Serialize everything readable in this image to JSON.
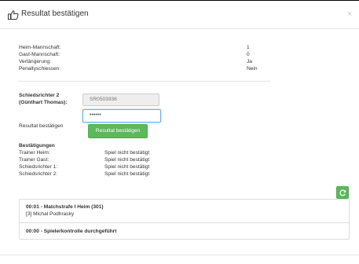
{
  "modal": {
    "title": "Resultat bestätigen",
    "close_label": "×"
  },
  "match_info": [
    {
      "label": "Heim-Mannschaft:",
      "value": "1"
    },
    {
      "label": "Gast-Mannschaft:",
      "value": "0"
    },
    {
      "label": "Verlängerung:",
      "value": "Ja"
    },
    {
      "label": "Penaltyschiessen:",
      "value": "Nein"
    }
  ],
  "referee": {
    "label_line1": "Schiedsrichter 2",
    "label_line2": "(Günthart Thomas):",
    "id_value": "SR0503936",
    "password_value": "••••••",
    "confirm_label": "Resultat bestätigen",
    "confirm_button": "Resultat bestätigen"
  },
  "confirmations": {
    "heading": "Bestätigungen",
    "rows": [
      {
        "label": "Trainer Heim:",
        "value": "Spiel nicht bestätigt"
      },
      {
        "label": "Trainer Gast:",
        "value": "Spiel nicht bestätigt"
      },
      {
        "label": "Schiedsrichter 1:",
        "value": "Spiel nicht bestätigt"
      },
      {
        "label": "Schiedsrichter 2:",
        "value": "Spiel nicht bestätigt"
      }
    ]
  },
  "events": [
    {
      "title": "00:01 - Matchstrafe I Heim (301)",
      "detail": "[3] Michal Podhrasky"
    },
    {
      "title": "00:00 - Spielerkontrolle durchgeführt"
    }
  ],
  "icons": {
    "title": "thumbs-up-icon",
    "refresh": "refresh-icon"
  },
  "colors": {
    "success": "#5cb85c",
    "focus": "#66afe9"
  }
}
